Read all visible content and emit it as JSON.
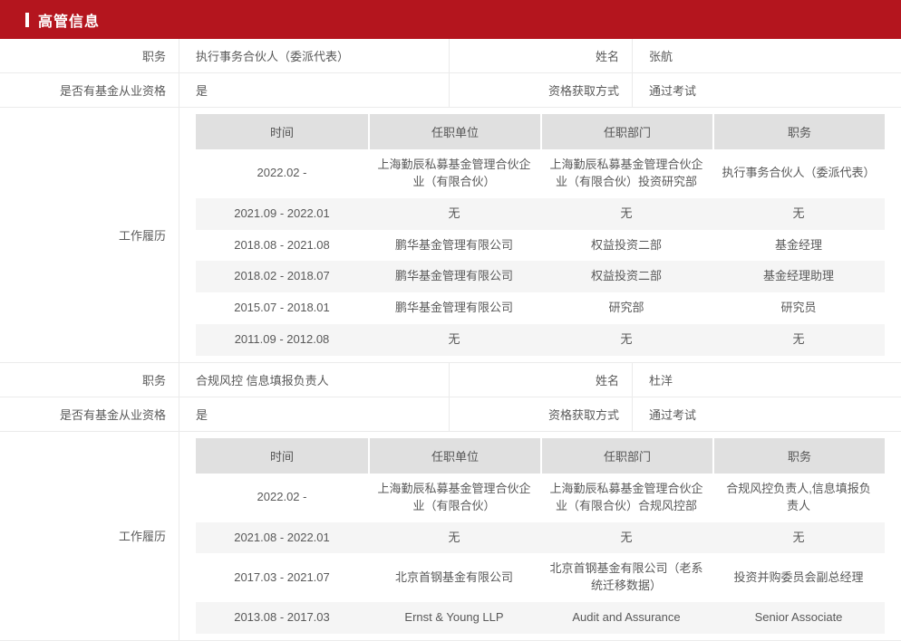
{
  "header": {
    "title": "高管信息"
  },
  "colors": {
    "accent_red": "#b4151e",
    "table_header_bg": "#e0e0e0",
    "stripe_bg": "#f5f5f5",
    "border": "#ebebeb"
  },
  "labels": {
    "position": "职务",
    "name": "姓名",
    "has_qualification": "是否有基金从业资格",
    "qualification_method": "资格获取方式",
    "work_history": "工作履历"
  },
  "work_history_columns": [
    "时间",
    "任职单位",
    "任职部门",
    "职务"
  ],
  "executives": [
    {
      "position": "执行事务合伙人（委派代表）",
      "name": "张航",
      "has_qualification": "是",
      "qualification_method": "通过考试",
      "work_history": [
        {
          "period": "2022.02 -",
          "company": "上海勤辰私募基金管理合伙企业（有限合伙）",
          "department": "上海勤辰私募基金管理合伙企业（有限合伙）投资研究部",
          "title": "执行事务合伙人（委派代表）"
        },
        {
          "period": "2021.09 - 2022.01",
          "company": "无",
          "department": "无",
          "title": "无"
        },
        {
          "period": "2018.08 - 2021.08",
          "company": "鹏华基金管理有限公司",
          "department": "权益投资二部",
          "title": "基金经理"
        },
        {
          "period": "2018.02 - 2018.07",
          "company": "鹏华基金管理有限公司",
          "department": "权益投资二部",
          "title": "基金经理助理"
        },
        {
          "period": "2015.07 - 2018.01",
          "company": "鹏华基金管理有限公司",
          "department": "研究部",
          "title": "研究员"
        },
        {
          "period": "2011.09 - 2012.08",
          "company": "无",
          "department": "无",
          "title": "无"
        }
      ]
    },
    {
      "position": "合规风控 信息填报负责人",
      "name": "杜洋",
      "has_qualification": "是",
      "qualification_method": "通过考试",
      "work_history": [
        {
          "period": "2022.02 -",
          "company": "上海勤辰私募基金管理合伙企业（有限合伙）",
          "department": "上海勤辰私募基金管理合伙企业（有限合伙）合规风控部",
          "title": "合规风控负责人,信息填报负责人"
        },
        {
          "period": "2021.08 - 2022.01",
          "company": "无",
          "department": "无",
          "title": "无"
        },
        {
          "period": "2017.03 - 2021.07",
          "company": "北京首钢基金有限公司",
          "department": "北京首钢基金有限公司（老系统迁移数据）",
          "title": "投资并购委员会副总经理"
        },
        {
          "period": "2013.08 - 2017.03",
          "company": "Ernst & Young LLP",
          "department": "Audit and Assurance",
          "title": "Senior Associate"
        }
      ]
    }
  ]
}
